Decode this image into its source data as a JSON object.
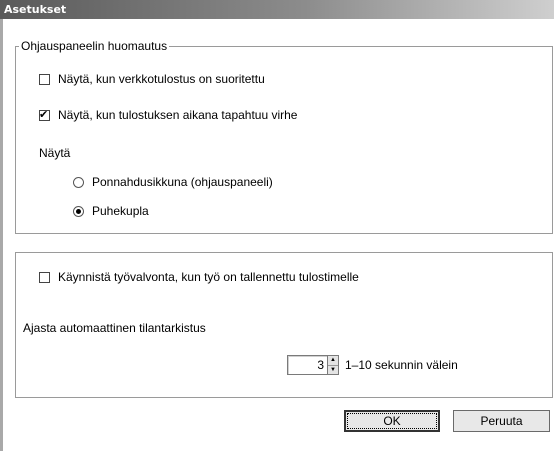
{
  "window": {
    "title": "Asetukset"
  },
  "group1": {
    "legend": "Ohjauspaneelin huomautus",
    "cb_network": {
      "label": "Näytä, kun verkkotulostus on suoritettu",
      "checked": false
    },
    "cb_error": {
      "label": "Näytä, kun tulostuksen aikana tapahtuu virhe",
      "checked": true
    },
    "display_label": "Näytä",
    "radio_popup": {
      "label": "Ponnahdusikkuna (ohjauspaneeli)",
      "selected": false
    },
    "radio_bubble": {
      "label": "Puhekupla",
      "selected": true
    }
  },
  "group2": {
    "cb_jobmonitor": {
      "label": "Käynnistä työvalvonta, kun työ on tallennettu tulostimelle",
      "checked": false
    },
    "schedule_label": "Ajasta automaattinen tilantarkistus",
    "spin_value": "3",
    "spin_suffix": "1–10 sekunnin välein"
  },
  "buttons": {
    "ok": "OK",
    "cancel": "Peruuta"
  }
}
